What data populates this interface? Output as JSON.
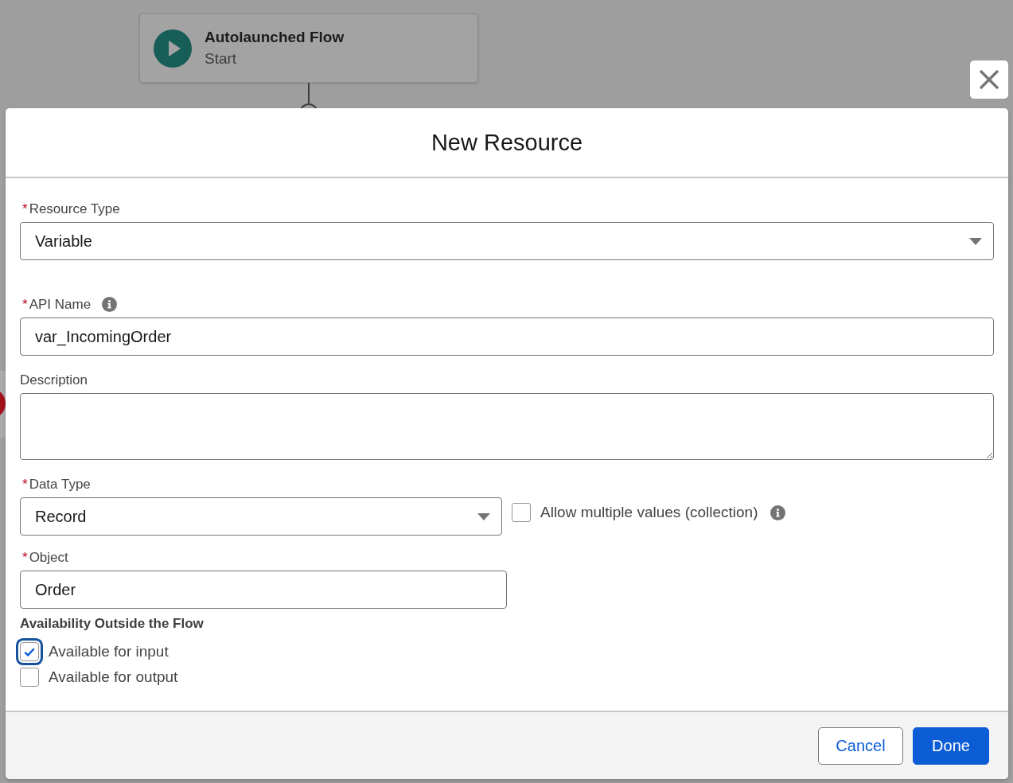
{
  "canvas": {
    "start_node": {
      "title": "Autolaunched Flow",
      "subtitle": "Start"
    }
  },
  "dialog": {
    "title": "New Resource",
    "resource_type": {
      "kind": "select",
      "required_mark": "*",
      "label": "Resource Type",
      "value": "Variable"
    },
    "api_name": {
      "kind": "input",
      "required_mark": "*",
      "label": "API Name",
      "info": true,
      "value": "var_IncomingOrder"
    },
    "description": {
      "kind": "textarea",
      "label": "Description"
    },
    "data_type": {
      "kind": "select",
      "required_mark": "*",
      "label": "Data Type",
      "value": "Record",
      "collection": {
        "label": "Allow multiple values (collection)",
        "checked": false,
        "info": true
      }
    },
    "object": {
      "kind": "input",
      "required_mark": "*",
      "label": "Object",
      "value": "Order"
    },
    "availability": {
      "heading": "Availability Outside the Flow",
      "options": [
        {
          "label": "Available for input",
          "checked": true,
          "focused": true
        },
        {
          "label": "Available for output",
          "checked": false,
          "focused": false
        }
      ]
    },
    "buttons": [
      {
        "label": "Cancel",
        "kind": "neutral"
      },
      {
        "label": "Done",
        "kind": "brand"
      }
    ]
  }
}
